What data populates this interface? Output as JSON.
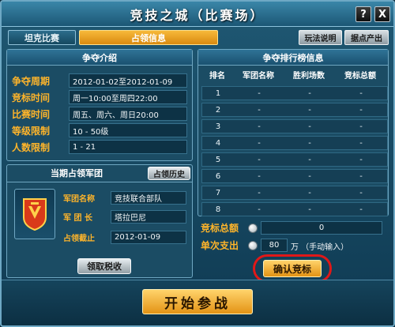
{
  "window": {
    "title": "竞技之城（比赛场）",
    "help_label": "?",
    "close_label": "X"
  },
  "tabs": [
    {
      "label": "坦克比赛"
    },
    {
      "label": "占领信息"
    }
  ],
  "top_buttons": {
    "rules": "玩法说明",
    "points_shop": "据点产出"
  },
  "contest_info": {
    "title": "争夺介绍",
    "rows": [
      {
        "label": "争夺周期",
        "value": "2012-01-02至2012-01-09"
      },
      {
        "label": "竞标时间",
        "value": "周一10:00至周四22:00"
      },
      {
        "label": "比赛时间",
        "value": "周五、周六、周日20:00"
      },
      {
        "label": "等级限制",
        "value": "10 - 50级"
      },
      {
        "label": "人数限制",
        "value": "1 - 21"
      }
    ]
  },
  "occupier": {
    "title": "当期占领军团",
    "history_button": "占领历史",
    "rows": [
      {
        "label": "军团名称",
        "value": "竞技联合部队"
      },
      {
        "label": "军 团 长",
        "value": "塔拉巴尼"
      },
      {
        "label": "占领截止",
        "value": "2012-01-09"
      }
    ],
    "collect_button": "领取税收"
  },
  "ranking": {
    "title": "争夺排行榜信息",
    "headers": [
      "排名",
      "军团名称",
      "胜利场数",
      "竞标总额"
    ],
    "rows": [
      [
        "1",
        "-",
        "-",
        "-"
      ],
      [
        "2",
        "-",
        "-",
        "-"
      ],
      [
        "3",
        "-",
        "-",
        "-"
      ],
      [
        "4",
        "-",
        "-",
        "-"
      ],
      [
        "5",
        "-",
        "-",
        "-"
      ],
      [
        "6",
        "-",
        "-",
        "-"
      ],
      [
        "7",
        "-",
        "-",
        "-"
      ],
      [
        "8",
        "-",
        "-",
        "-"
      ]
    ]
  },
  "bid": {
    "total_label": "竞标总额",
    "total_value": "0",
    "single_label": "单次支出",
    "single_value": "80",
    "single_unit": "万 （手动输入）",
    "confirm_button": "确认竞标"
  },
  "start_button": "开始参战",
  "colors": {
    "accent_orange": "#ffb52a",
    "highlight_ring": "#e01818",
    "panel_bg": "#1b4c64"
  }
}
